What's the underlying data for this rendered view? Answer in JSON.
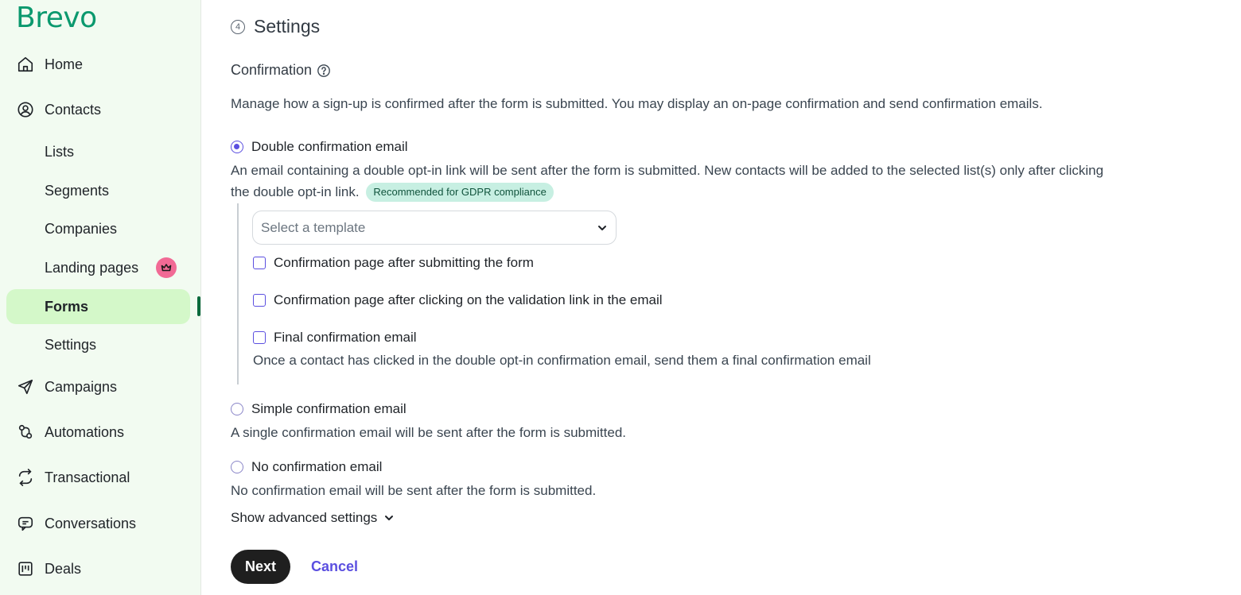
{
  "brand": {
    "logo_text": "Brevo",
    "color": "#0b996e"
  },
  "sidebar": {
    "items": [
      {
        "label": "Home",
        "icon": "home-icon"
      },
      {
        "label": "Contacts",
        "icon": "contacts-icon"
      },
      {
        "label": "Lists"
      },
      {
        "label": "Segments"
      },
      {
        "label": "Companies"
      },
      {
        "label": "Landing pages",
        "icon": "crown-icon"
      },
      {
        "label": "Forms",
        "active": true
      },
      {
        "label": "Settings"
      },
      {
        "label": "Campaigns",
        "icon": "send-icon"
      },
      {
        "label": "Automations",
        "icon": "automations-icon"
      },
      {
        "label": "Transactional",
        "icon": "transactional-icon"
      },
      {
        "label": "Conversations",
        "icon": "chat-icon"
      },
      {
        "label": "Deals",
        "icon": "deals-icon"
      }
    ]
  },
  "main": {
    "step_number": "4",
    "step_title": "Settings",
    "section_label": "Confirmation",
    "description": "Manage how a sign-up is confirmed after the form is submitted. You may display an on-page confirmation and send confirmation emails.",
    "options": [
      {
        "label": "Double confirmation email",
        "checked": true,
        "help_line1": "An email containing a double opt-in link will be sent after the form is submitted. New contacts will be added to the selected list(s) only after clicking",
        "help_line2": "the double opt-in link.",
        "badge": "Recommended for GDPR compliance"
      },
      {
        "label": "Simple confirmation email",
        "checked": false,
        "help": "A single confirmation email will be sent after the form is submitted."
      },
      {
        "label": "No confirmation email",
        "checked": false,
        "help": "No confirmation email will be sent after the form is submitted."
      }
    ],
    "template_select": {
      "placeholder": "Select a template"
    },
    "checkboxes": [
      {
        "label": "Confirmation page after submitting the form",
        "checked": false
      },
      {
        "label": "Confirmation page after clicking on the validation link in the email",
        "checked": false
      },
      {
        "label": "Final confirmation email",
        "checked": false,
        "help": "Once a contact has clicked in the double opt-in confirmation email, send them a final confirmation email"
      }
    ],
    "advanced_settings_label": "Show advanced settings",
    "next_label": "Next",
    "cancel_label": "Cancel"
  }
}
